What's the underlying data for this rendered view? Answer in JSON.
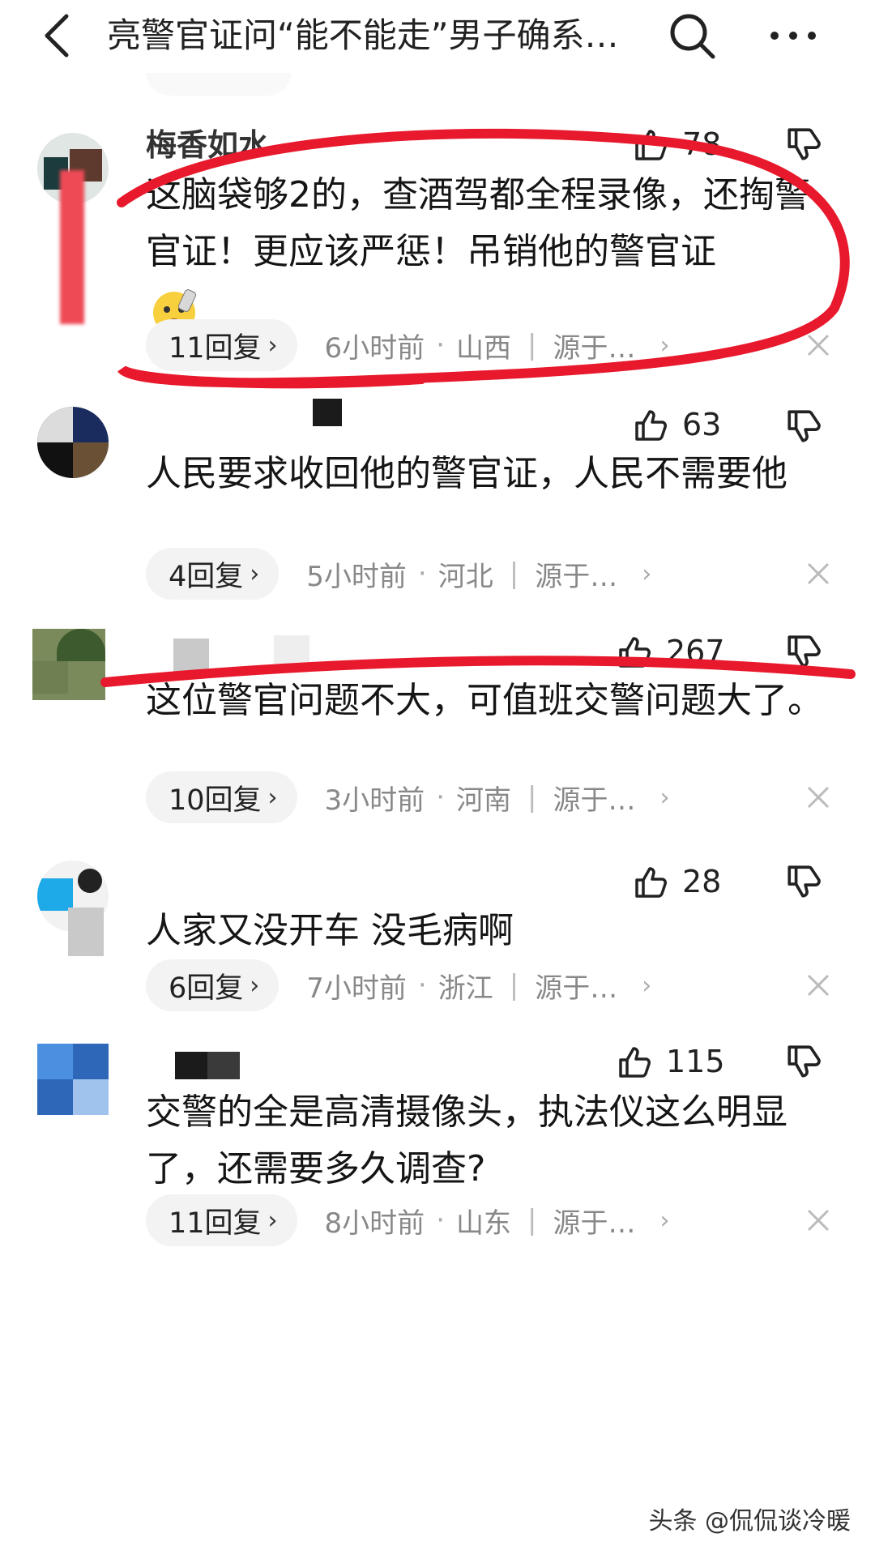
{
  "header": {
    "title": "亮警官证问“能不能走”男子确系…"
  },
  "comments": [
    {
      "username": "梅香如水",
      "likes": "78",
      "text": "这脑袋够2的，查酒驾都全程录像，还掏警官证！更应该严惩！吊销他的警官证",
      "emoji": "emoji-face",
      "replies": "11回复",
      "time": "6小时前",
      "location": "山西",
      "source": "源于…"
    },
    {
      "username": "",
      "likes": "63",
      "text": "人民要求收回他的警官证，人民不需要他",
      "replies": "4回复",
      "time": "5小时前",
      "location": "河北",
      "source": "源于…"
    },
    {
      "username": "",
      "likes": "267",
      "text": "这位警官问题不大，可值班交警问题大了。",
      "replies": "10回复",
      "time": "3小时前",
      "location": "河南",
      "source": "源于…"
    },
    {
      "username": "",
      "likes": "28",
      "text": "人家又没开车 没毛病啊",
      "replies": "6回复",
      "time": "7小时前",
      "location": "浙江",
      "source": "源于…"
    },
    {
      "username": "",
      "likes": "115",
      "text": "交警的全是高清摄像头，执法仪这么明显了，还需要多久调查?",
      "replies": "11回复",
      "time": "8小时前",
      "location": "山东",
      "source": "源于…"
    }
  ],
  "watermark": "头条 @侃侃谈冷暖",
  "colors": {
    "annotation_red": "#e8192c",
    "meta_gray": "#888888",
    "pill_bg": "#f3f3f3"
  }
}
